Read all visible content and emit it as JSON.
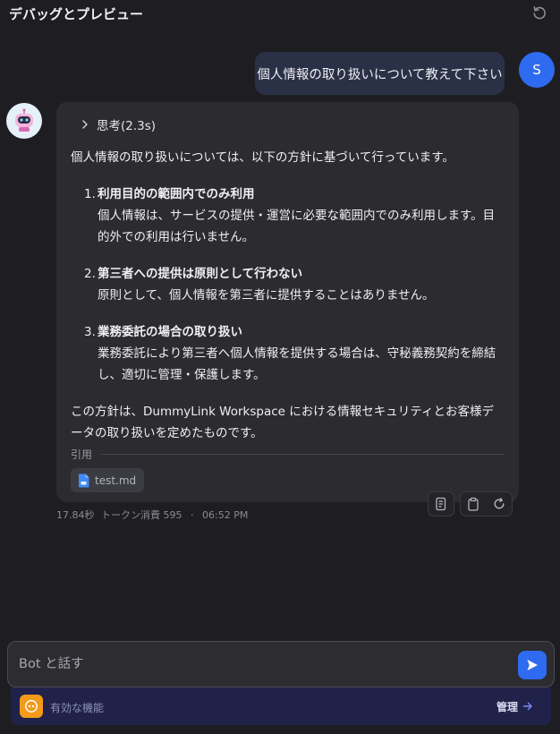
{
  "header": {
    "title": "デバッグとプレビュー",
    "reset_icon": "refresh-icon"
  },
  "user": {
    "avatar_initial": "S",
    "message": "個人情報の取り扱いについて教えて下さい"
  },
  "bot": {
    "avatar_icon": "robot-icon",
    "thinking_label": "思考(2.3s)",
    "intro": "個人情報の取り扱いについては、以下の方針に基づいて行っています。",
    "items": [
      {
        "num": "1.",
        "title": "利用目的の範囲内でのみ利用",
        "body": "個人情報は、サービスの提供・運営に必要な範囲内でのみ利用します。目的外での利用は行いません。"
      },
      {
        "num": "2.",
        "title": "第三者への提供は原則として行わない",
        "body": "原則として、個人情報を第三者に提供することはありません。"
      },
      {
        "num": "3.",
        "title": "業務委託の場合の取り扱い",
        "body": "業務委託により第三者へ個人情報を提供する場合は、守秘義務契約を締結し、適切に管理・保護します。"
      }
    ],
    "conclusion": "この方針は、DummyLink Workspace における情報セキュリティとお客様データの取り扱いを定めたものです。",
    "citation_label": "引用",
    "citation_file": "test.md",
    "meta": {
      "duration": "17.84秒",
      "tokens": "トークン消費 595",
      "separator": "·",
      "time": "06:52 PM"
    }
  },
  "input": {
    "placeholder": "Bot と話す",
    "send_icon": "send-icon"
  },
  "features": {
    "label": "有効な機能",
    "manage_label": "管理"
  },
  "colors": {
    "accent": "#2f6bf0",
    "background": "#1e1e22",
    "bubble": "#2b2b30",
    "feature_bar": "#20224a",
    "feature_icon": "#f29a19"
  }
}
